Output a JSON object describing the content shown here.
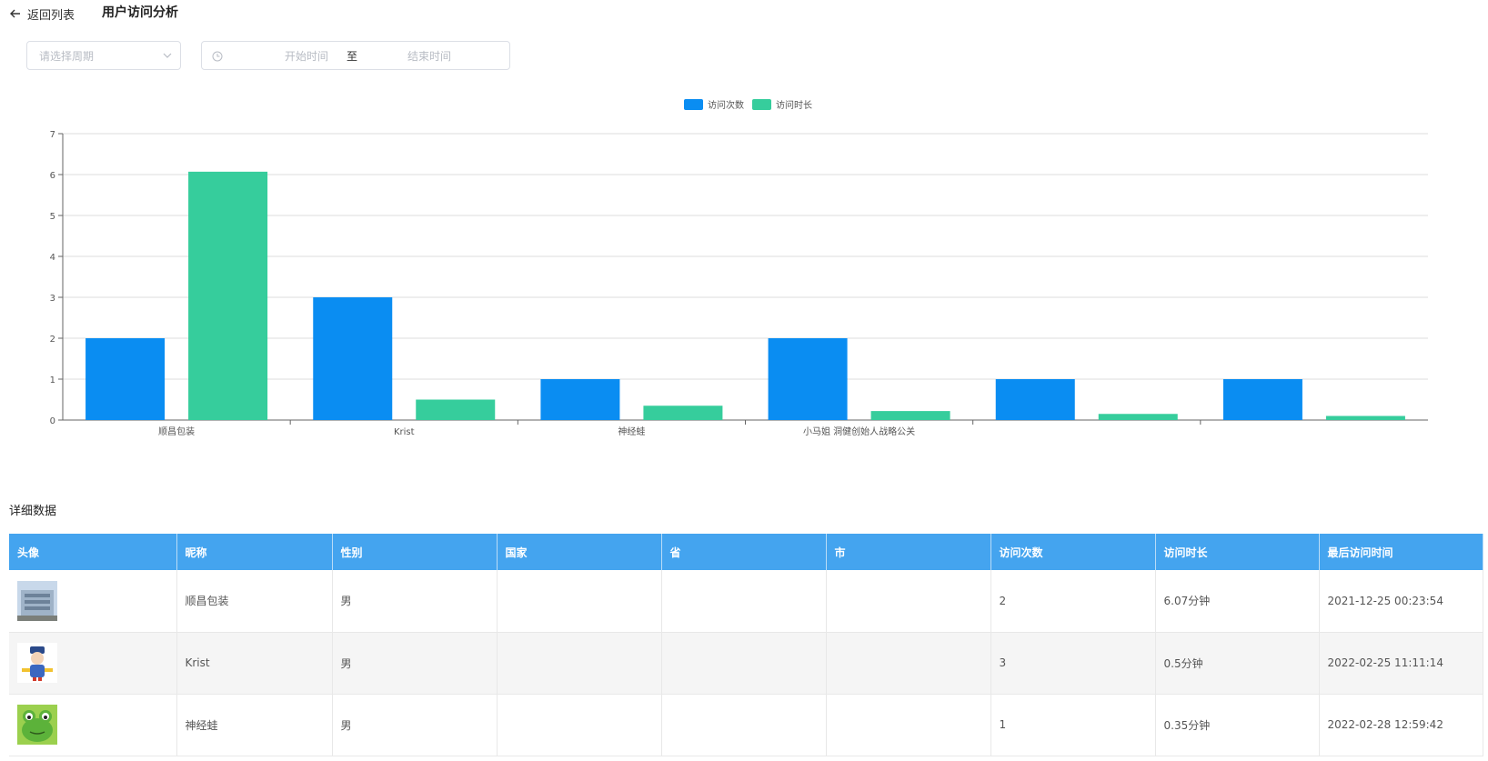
{
  "header": {
    "back_label": "返回列表",
    "title": "用户访问分析"
  },
  "filters": {
    "period_placeholder": "请选择周期",
    "start_placeholder": "开始时间",
    "range_separator": "至",
    "end_placeholder": "结束时间"
  },
  "chart_data": {
    "type": "bar",
    "categories": [
      "顺昌包装",
      "Krist",
      "神经蛙",
      "小马姐 洞健创始人战略公关",
      "",
      ""
    ],
    "series": [
      {
        "name": "访问次数",
        "color": "#0a8df2",
        "values": [
          2,
          3,
          1,
          2,
          1,
          1
        ]
      },
      {
        "name": "访问时长",
        "color": "#36cd9c",
        "values": [
          6.07,
          0.5,
          0.35,
          0.22,
          0.15,
          0.1
        ]
      }
    ],
    "ylim": [
      0,
      7
    ],
    "yticks": [
      "0",
      "1",
      "2",
      "3",
      "4",
      "5",
      "6",
      "7"
    ],
    "legend_position": "top-center",
    "grid": true
  },
  "details": {
    "title": "详细数据",
    "columns": [
      "头像",
      "昵称",
      "性别",
      "国家",
      "省",
      "市",
      "访问次数",
      "访问时长",
      "最后访问时间"
    ],
    "rows": [
      {
        "avatar": "building-avatar",
        "nickname": "顺昌包装",
        "gender": "男",
        "country": "",
        "province": "",
        "city": "",
        "visits": "2",
        "duration": "6.07分钟",
        "last_visit": "2021-12-25 00:23:54"
      },
      {
        "avatar": "cartoon-character-avatar",
        "nickname": "Krist",
        "gender": "男",
        "country": "",
        "province": "",
        "city": "",
        "visits": "3",
        "duration": "0.5分钟",
        "last_visit": "2022-02-25 11:11:14"
      },
      {
        "avatar": "frog-avatar",
        "nickname": "神经蛙",
        "gender": "男",
        "country": "",
        "province": "",
        "city": "",
        "visits": "1",
        "duration": "0.35分钟",
        "last_visit": "2022-02-28 12:59:42"
      }
    ]
  }
}
